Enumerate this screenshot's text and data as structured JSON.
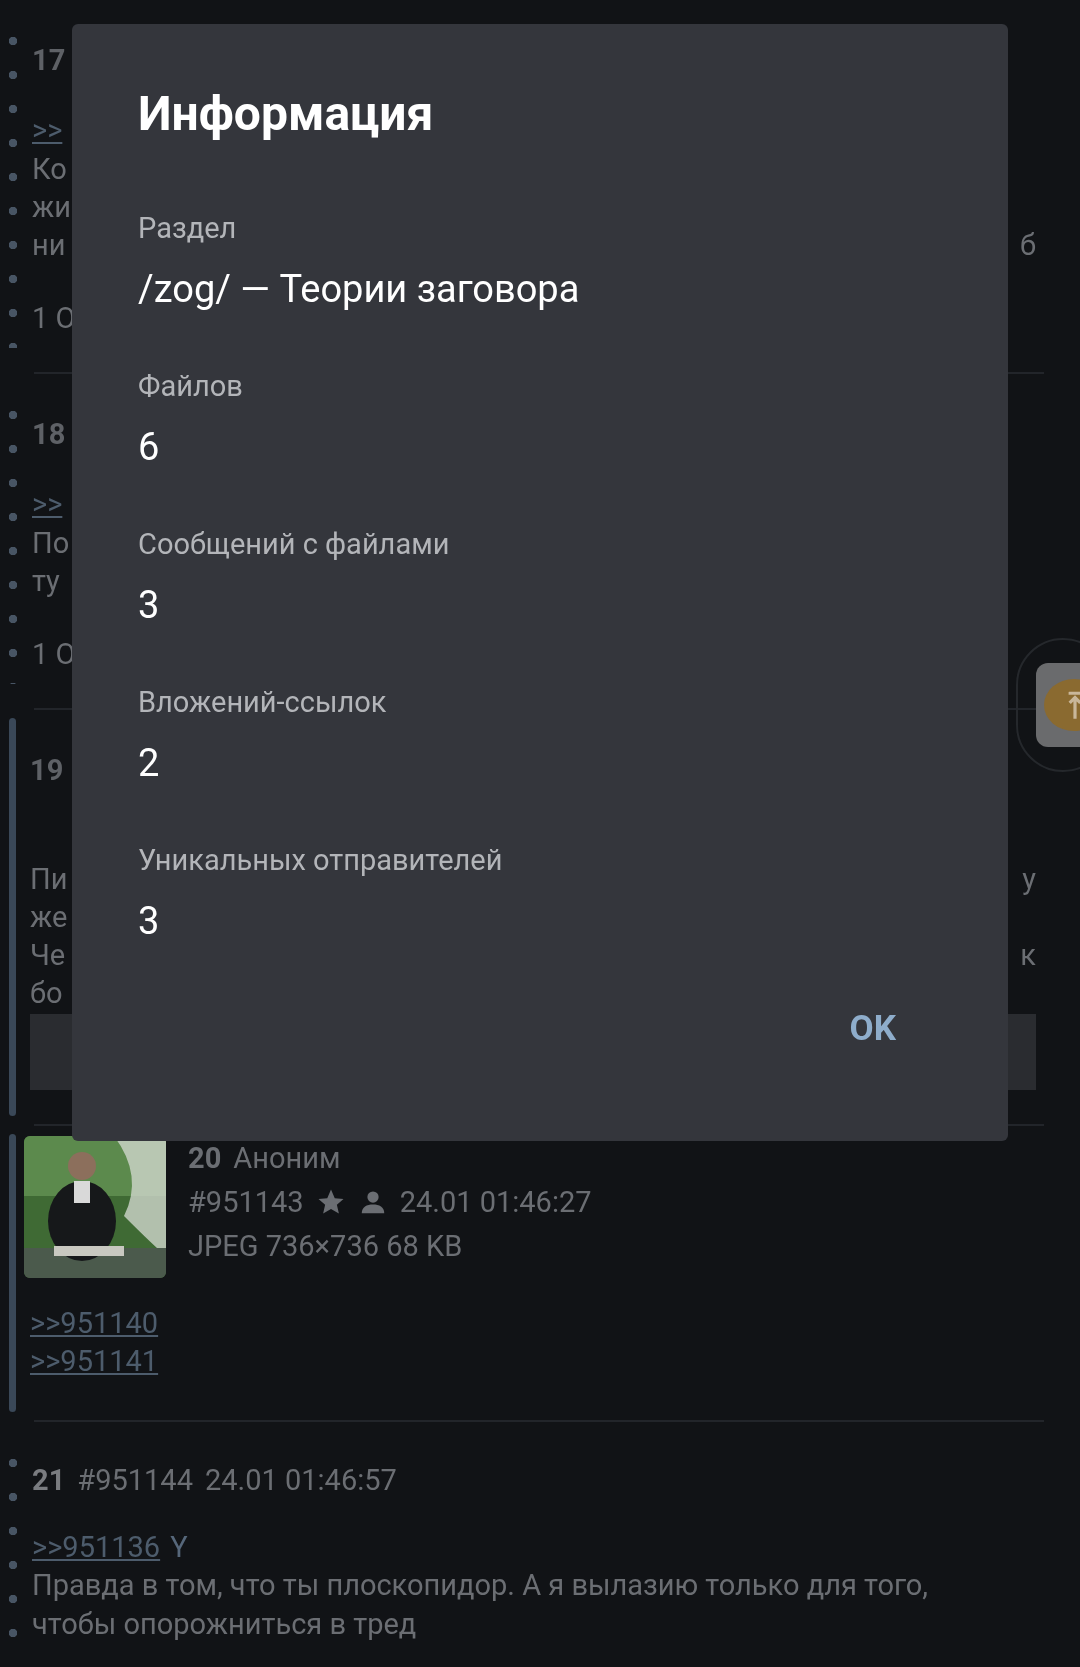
{
  "posts": [
    {
      "kind": "hidden",
      "highlighted": false,
      "number": "17",
      "reply_link": ">>",
      "lines": [
        {
          "left": "Ко"
        },
        {
          "left": "жи"
        },
        {
          "left": "ни",
          "right": "б"
        }
      ],
      "footer": "1 О"
    },
    {
      "kind": "hidden",
      "highlighted": false,
      "number": "18",
      "reply_link": ">>",
      "lines": [
        {
          "left": "По"
        },
        {
          "left": "ту"
        }
      ],
      "footer": "1 О"
    },
    {
      "kind": "hidden",
      "highlighted": true,
      "number": "19",
      "lines": [
        {
          "left": "Пи",
          "right": "у"
        },
        {
          "left": "же"
        },
        {
          "left": "Че",
          "right": "к"
        },
        {
          "left": "бо"
        }
      ],
      "attachment": true
    },
    {
      "highlighted": true,
      "number": "20",
      "author": "Аноним",
      "post_id": "#951143",
      "date": "24.01 01:46:27",
      "file_info": "JPEG 736×736 68 KB",
      "links": [
        ">>951140",
        ">>951141"
      ]
    },
    {
      "kind": "text",
      "highlighted": false,
      "number": "21",
      "post_id": "#951144",
      "date": "24.01 01:46:57",
      "reply_link": ">>951136",
      "reply_suffix": "Y",
      "text": "Правда в том, что ты плоскопидор. А я вылазию только для того, чтобы опорожниться в тред"
    }
  ],
  "dialog": {
    "title": "Информация",
    "fields": [
      {
        "label": "Раздел",
        "value": "/zog/ — Теории заговора"
      },
      {
        "label": "Файлов",
        "value": "6"
      },
      {
        "label": "Сообщений с файлами",
        "value": "3"
      },
      {
        "label": "Вложений-ссылок",
        "value": "2"
      },
      {
        "label": "Уникальных отправителей",
        "value": "3"
      }
    ],
    "ok_button": "OK"
  }
}
